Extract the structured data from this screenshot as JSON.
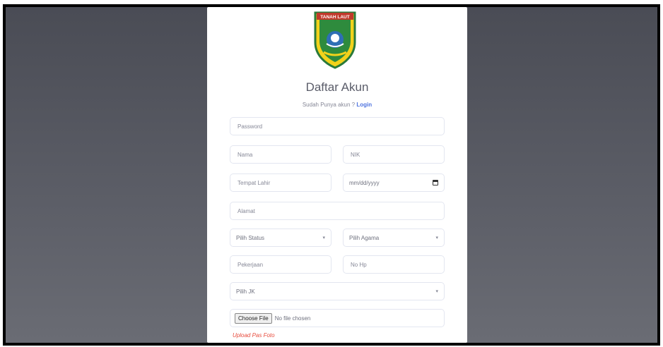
{
  "logo": {
    "text": "TANAH LAUT"
  },
  "title": "Daftar Akun",
  "subtitle": {
    "text": "Sudah Punya akun ? ",
    "link": "Login"
  },
  "form": {
    "password": {
      "placeholder": "Password"
    },
    "nama": {
      "placeholder": "Nama"
    },
    "nik": {
      "placeholder": "NIK"
    },
    "tempat_lahir": {
      "placeholder": "Tempat Lahir"
    },
    "tanggal_lahir": {
      "placeholder": "mm/dd/yyyy"
    },
    "alamat": {
      "placeholder": "Alamat"
    },
    "status": {
      "selected": "Pilih Status"
    },
    "agama": {
      "selected": "Pilih Agama"
    },
    "pekerjaan": {
      "placeholder": "Pekerjaan"
    },
    "no_hp": {
      "placeholder": "No Hp"
    },
    "jk": {
      "selected": "Pilih JK"
    },
    "file": {
      "button": "Choose File",
      "status": "No file chosen"
    },
    "error": "Upload Pas Foto"
  },
  "colors": {
    "link": "#4e73df",
    "error": "#e74a3b",
    "background": "#5b5d66"
  }
}
